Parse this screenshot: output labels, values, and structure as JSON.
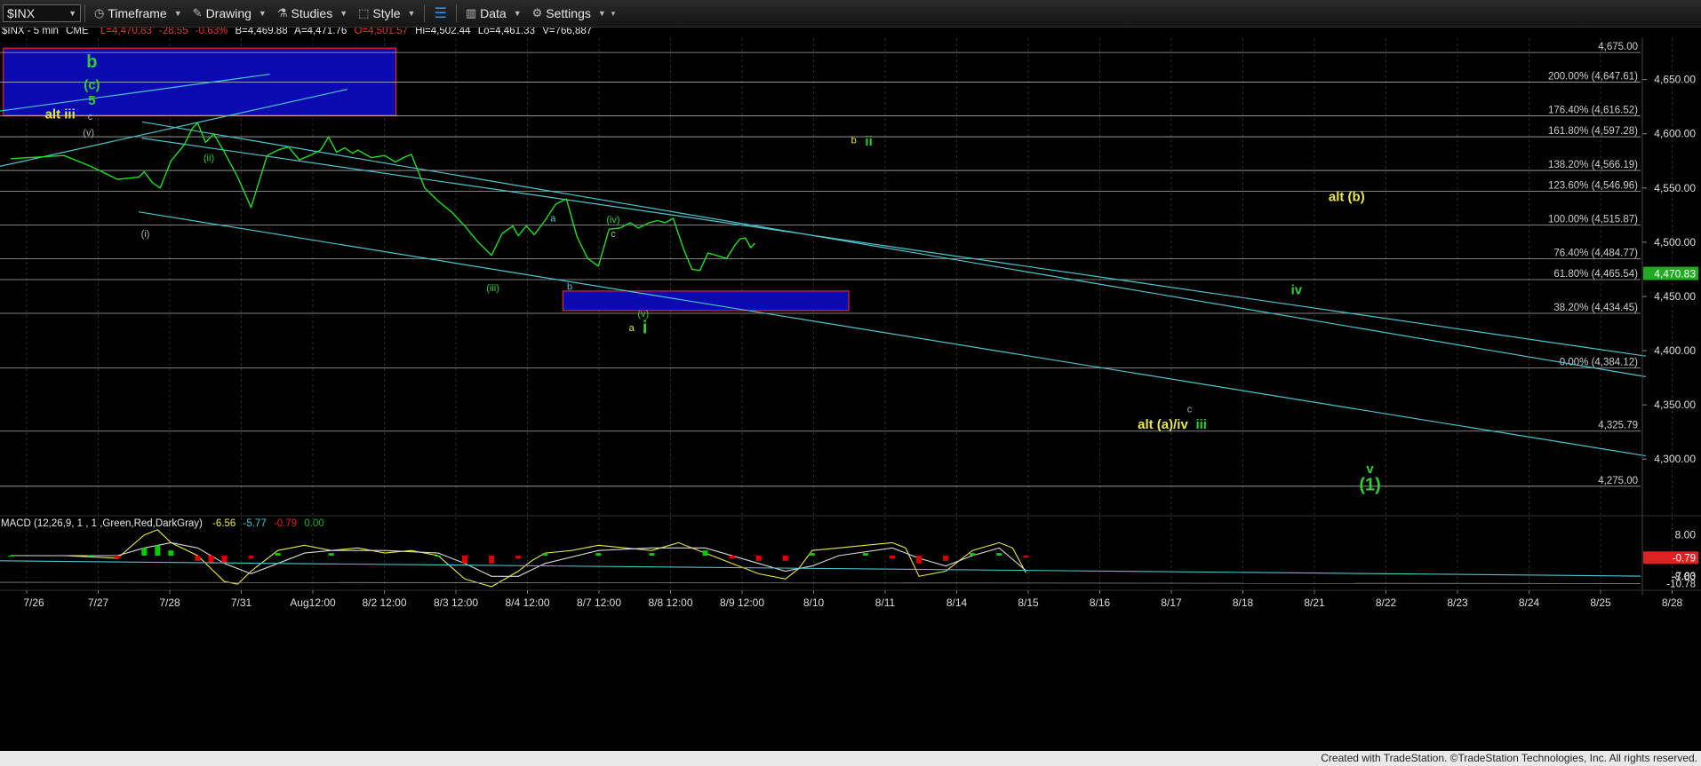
{
  "toolbar": {
    "symbol": "$INX",
    "timeframe": "Timeframe",
    "drawing": "Drawing",
    "studies": "Studies",
    "style": "Style",
    "data": "Data",
    "settings": "Settings"
  },
  "header": {
    "symbol": "$INX - 5 min",
    "exchange": "CME",
    "last": "L=4,470.83",
    "change": "-28.55",
    "change_pct": "-0.63%",
    "bid": "B=4,469.88",
    "ask": "A=4,471.76",
    "open": "O=4,501.57",
    "high": "Hi=4,502.44",
    "low": "Lo=4,461.33",
    "volume": "V=766,887"
  },
  "colors": {
    "price": "#22dd22",
    "fib_lines": "#c8c8c8",
    "channels": "#4fc4cf",
    "target_box": "#0a0ab0",
    "target_box_border": "#e22",
    "label_green": "#33cc33",
    "label_yellow": "#e8e84a",
    "macd_hist_up": "#00cc00",
    "macd_hist_down": "#dd0000",
    "negative_tag": "#dd2222",
    "last_price_tag": "#22aa22"
  },
  "chart_data": [
    {
      "type": "line",
      "title": "$INX - 5 min",
      "y_axis_ticks": [
        4300,
        4350,
        4400,
        4450,
        4500,
        4550,
        4600,
        4650
      ],
      "y_axis_labels": [
        "4,300.00",
        "4,350.00",
        "4,400.00",
        "4,450.00",
        "4,500.00",
        "4,550.00",
        "4,600.00",
        "4,650.00"
      ],
      "ylim": [
        4256,
        4680
      ],
      "x_axis_labels": [
        "7/26",
        "7/27",
        "7/28",
        "7/31",
        "Aug12:00",
        "8/2 12:00",
        "8/3 12:00",
        "8/4 12:00",
        "8/7 12:00",
        "8/8 12:00",
        "8/9 12:00",
        "8/10",
        "8/11",
        "8/14",
        "8/15",
        "8/16",
        "8/17",
        "8/18",
        "8/21",
        "8/22",
        "8/23",
        "8/24",
        "8/25",
        "8/28"
      ],
      "price_series": {
        "name": "$INX",
        "x": [
          0,
          2,
          3,
          4,
          4.8,
          5,
          5.3,
          5.6,
          6,
          6.5,
          6.8,
          7,
          7.3,
          7.6,
          8,
          8.5,
          9,
          9.6,
          10,
          10.4,
          10.8,
          11.2,
          11.6,
          11.9,
          12.2,
          12.5,
          12.8,
          13,
          13.5,
          14,
          14.4,
          14.7,
          15,
          15.5,
          16,
          16.5,
          17,
          17.5,
          18,
          18.4,
          18.8,
          19,
          19.3,
          19.6,
          20,
          20.4,
          20.8,
          21.2,
          21.6,
          22,
          22.4,
          22.8,
          23.2,
          23.5,
          23.9,
          24.2,
          24.5,
          24.8,
          25.2,
          25.5,
          25.8,
          26.1,
          26.4,
          26.8,
          27.1,
          27.3,
          27.5,
          27.7,
          27.85
        ],
        "values": [
          4577,
          4580,
          4570,
          4558,
          4560,
          4565,
          4555,
          4550,
          4575,
          4590,
          4605,
          4610,
          4592,
          4600,
          4583,
          4560,
          4532,
          4580,
          4585,
          4588,
          4576,
          4580,
          4585,
          4597,
          4583,
          4587,
          4582,
          4585,
          4578,
          4580,
          4574,
          4578,
          4581,
          4550,
          4538,
          4528,
          4515,
          4500,
          4488,
          4508,
          4515,
          4506,
          4515,
          4507,
          4520,
          4535,
          4540,
          4505,
          4485,
          4478,
          4512,
          4513,
          4518,
          4513,
          4518,
          4520,
          4518,
          4522,
          4493,
          4475,
          4474,
          4490,
          4488,
          4485,
          4497,
          4503,
          4504,
          4495,
          4499,
          4480,
          4468,
          4466,
          4470.83
        ]
      },
      "last_price": "4,470.83",
      "fib_levels": [
        {
          "value": 4675.0,
          "label": "4,675.00"
        },
        {
          "value": 4647.61,
          "label": "200.00% (4,647.61)"
        },
        {
          "value": 4616.52,
          "label": "176.40% (4,616.52)"
        },
        {
          "value": 4597.28,
          "label": "161.80% (4,597.28)"
        },
        {
          "value": 4566.19,
          "label": "138.20% (4,566.19)"
        },
        {
          "value": 4546.96,
          "label": "123.60% (4,546.96)"
        },
        {
          "value": 4515.87,
          "label": "100.00% (4,515.87)"
        },
        {
          "value": 4484.77,
          "label": "76.40% (4,484.77)"
        },
        {
          "value": 4465.54,
          "label": "61.80% (4,465.54)"
        },
        {
          "value": 4434.45,
          "label": "38.20% (4,434.45)"
        },
        {
          "value": 4384.12,
          "label": "0.00% (4,384.12)"
        },
        {
          "value": 4325.79,
          "label": "4,325.79"
        },
        {
          "value": 4275.0,
          "label": "4,275.00"
        }
      ],
      "channels": [
        {
          "from": [
            0,
            4621
          ],
          "to": [
            10.5,
            4655
          ]
        },
        {
          "from": [
            0,
            4570
          ],
          "to": [
            13.5,
            4641
          ]
        },
        {
          "from": [
            8.5,
            4611
          ],
          "to": [
            64,
            4376
          ]
        },
        {
          "from": [
            8.5,
            4596
          ],
          "to": [
            64,
            4395
          ]
        },
        {
          "from": [
            8.3,
            4528
          ],
          "to": [
            64,
            4303
          ]
        }
      ],
      "target_boxes": [
        {
          "x_from": 0.2,
          "x_to": 23.7,
          "y_from": 4617,
          "y_to": 4679
        },
        {
          "x_from": 33.7,
          "x_to": 50.8,
          "y_from": 4437,
          "y_to": 4455
        }
      ],
      "wave_labels": [
        {
          "text": "b",
          "x": 5.5,
          "y": 4661,
          "color": "green",
          "size": "big"
        },
        {
          "text": "(c)",
          "x": 5.5,
          "y": 4641,
          "color": "green",
          "size": "mid"
        },
        {
          "text": "5",
          "x": 5.5,
          "y": 4627,
          "color": "green",
          "size": "mid"
        },
        {
          "text": "c",
          "x": 5.4,
          "y": 4613,
          "color": "gray",
          "size": "small"
        },
        {
          "text": "alt iii",
          "x": 3.6,
          "y": 4614,
          "color": "yellow",
          "size": "mid"
        },
        {
          "text": "(v)",
          "x": 5.3,
          "y": 4598,
          "color": "gray",
          "size": "small"
        },
        {
          "text": "(ii)",
          "x": 12.5,
          "y": 4575,
          "color": "green",
          "size": "small"
        },
        {
          "text": "(i)",
          "x": 8.7,
          "y": 4505,
          "color": "gray",
          "size": "small"
        },
        {
          "text": "(iii)",
          "x": 29.5,
          "y": 4455,
          "color": "green",
          "size": "small"
        },
        {
          "text": "a",
          "x": 33.1,
          "y": 4519,
          "color": "teal",
          "size": "small"
        },
        {
          "text": "b",
          "x": 34.1,
          "y": 4456,
          "color": "teal",
          "size": "small"
        },
        {
          "text": "(iv)",
          "x": 36.7,
          "y": 4518,
          "color": "green",
          "size": "small"
        },
        {
          "text": "c",
          "x": 36.7,
          "y": 4505,
          "color": "gray",
          "size": "small"
        },
        {
          "text": "(v)",
          "x": 38.5,
          "y": 4431,
          "color": "green",
          "size": "small"
        },
        {
          "text": "a",
          "x": 37.8,
          "y": 4418,
          "color": "yellow",
          "size": "small"
        },
        {
          "text": "i",
          "x": 38.6,
          "y": 4416,
          "color": "green",
          "size": "big"
        },
        {
          "text": "b",
          "x": 51.1,
          "y": 4591,
          "color": "yellow",
          "size": "small"
        },
        {
          "text": "ii",
          "x": 52.0,
          "y": 4589,
          "color": "green",
          "size": "mid"
        },
        {
          "text": "alt (b)",
          "x": 80.6,
          "y": 4538,
          "color": "yellow",
          "size": "mid"
        },
        {
          "text": "iv",
          "x": 77.6,
          "y": 4452,
          "color": "green",
          "size": "mid"
        },
        {
          "text": "c",
          "x": 71.2,
          "y": 4343,
          "color": "gray",
          "size": "small"
        },
        {
          "text": "alt (a)/iv",
          "x": 69.6,
          "y": 4328,
          "color": "yellow",
          "size": "mid"
        },
        {
          "text": "iii",
          "x": 71.9,
          "y": 4328,
          "color": "green",
          "size": "mid"
        },
        {
          "text": "v",
          "x": 82.0,
          "y": 4287,
          "color": "green",
          "size": "mid"
        },
        {
          "text": "(1)",
          "x": 82.0,
          "y": 4271,
          "color": "green",
          "size": "big"
        }
      ]
    },
    {
      "type": "line",
      "title": "MACD (12,26,9, 1 , 1 ,Green,Red,DarkGray)",
      "readouts": [
        "-6.56",
        "-5.77",
        "-0.79",
        "0.00"
      ],
      "y_axis_labels": [
        "8.00",
        "-8.00"
      ],
      "y_axis_values": [
        8,
        -8
      ],
      "ylim": [
        -12,
        12
      ],
      "tags": [
        {
          "value": -0.79,
          "label": "-0.79"
        },
        {
          "value": -7.83,
          "label": "-7.83"
        },
        {
          "value": -10.78,
          "label": "-10.78"
        }
      ],
      "series": [
        {
          "name": "MACD",
          "x": [
            0,
            2,
            4,
            5,
            5.5,
            6,
            7,
            8,
            8.5,
            9,
            10,
            11,
            12,
            13,
            14,
            15,
            16,
            17,
            18,
            19,
            19.5,
            20,
            21,
            22,
            23,
            24,
            25,
            26,
            27,
            28,
            29,
            29.5,
            30,
            31,
            32,
            33,
            33.5,
            34,
            35,
            36,
            37,
            37.5,
            38
          ],
          "values": [
            0,
            0,
            -1,
            8,
            10,
            5,
            0,
            -10,
            -11,
            -6,
            2,
            4,
            2,
            3,
            1,
            2,
            0,
            -9,
            -12,
            -6,
            -2,
            1,
            2,
            4,
            3,
            2,
            5,
            1,
            -3,
            -7,
            -9,
            -5,
            2,
            3,
            4,
            5,
            3,
            -8,
            -6,
            2,
            5,
            3,
            -6.56
          ]
        },
        {
          "name": "Signal",
          "x": [
            0,
            2,
            4,
            5,
            6,
            7,
            8,
            9,
            10,
            11,
            12,
            14,
            16,
            17,
            18,
            19,
            20,
            22,
            24,
            26,
            28,
            29,
            30,
            31,
            33,
            34,
            35,
            36,
            37,
            38
          ],
          "values": [
            0,
            0,
            0,
            3,
            5,
            3,
            -3,
            -7,
            -3,
            1,
            2,
            2,
            1,
            -3,
            -8,
            -8,
            -3,
            2,
            3,
            3,
            -3,
            -6,
            -4,
            0,
            3,
            -1,
            -4,
            0,
            3,
            -5.77
          ]
        },
        {
          "name": "Histogram",
          "x": [
            0,
            3,
            4,
            5,
            5.5,
            6,
            7,
            7.5,
            8,
            9,
            10,
            12,
            16,
            17,
            18,
            19,
            20,
            22,
            24,
            26,
            27,
            28,
            29,
            30,
            32,
            33,
            34,
            35,
            36,
            37,
            38
          ],
          "values": [
            0,
            0,
            -1,
            3,
            4,
            2,
            -2,
            -3,
            -3,
            -1,
            1,
            1,
            0,
            -3,
            -3,
            -1,
            1,
            1,
            1,
            2,
            -1,
            -2,
            -2,
            1,
            1,
            -1,
            -3,
            -2,
            1,
            1,
            -0.79
          ]
        }
      ]
    }
  ],
  "footer": {
    "credit": "Created with TradeStation. ©TradeStation Technologies, Inc. All rights reserved."
  }
}
